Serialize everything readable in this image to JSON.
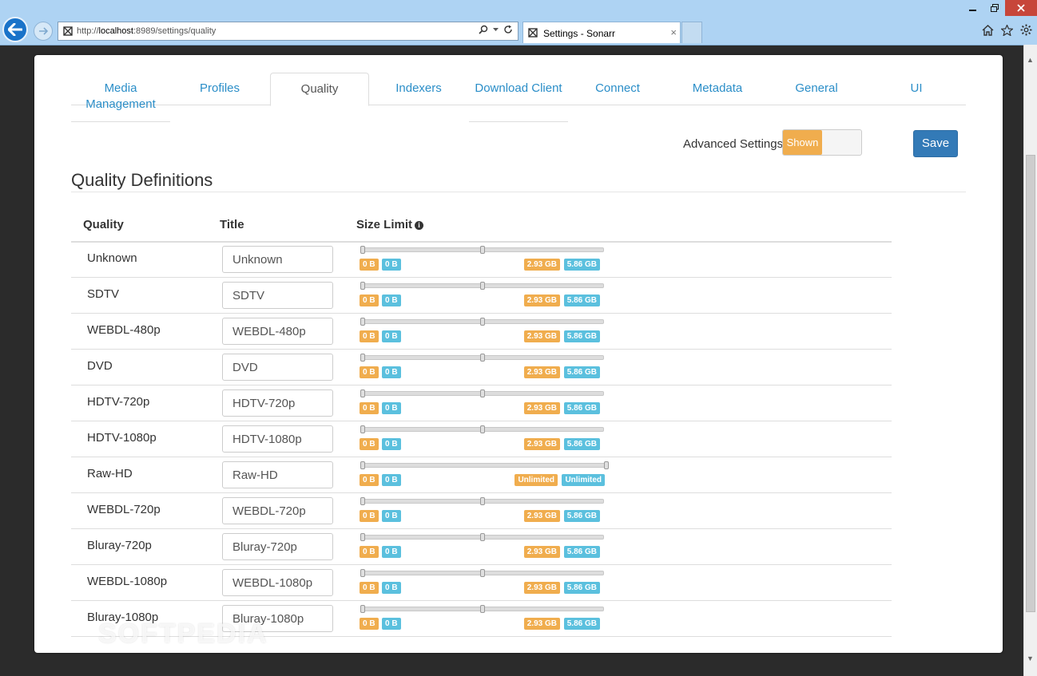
{
  "browser": {
    "url_prefix": "http://",
    "url_host": "localhost",
    "url_rest": ":8989/settings/quality",
    "tab_title": "Settings - Sonarr",
    "tab_close": "×"
  },
  "nav": {
    "tabs": [
      {
        "label": "Media Management"
      },
      {
        "label": "Profiles"
      },
      {
        "label": "Quality"
      },
      {
        "label": "Indexers"
      },
      {
        "label": "Download Client"
      },
      {
        "label": "Connect"
      },
      {
        "label": "Metadata"
      },
      {
        "label": "General"
      },
      {
        "label": "UI"
      }
    ],
    "active": "Quality"
  },
  "advanced": {
    "label": "Advanced Settings",
    "toggle_on_label": "Shown"
  },
  "save_label": "Save",
  "section_title": "Quality Definitions",
  "table": {
    "headers": {
      "quality": "Quality",
      "title": "Title",
      "size_limit": "Size Limit"
    },
    "rows": [
      {
        "quality": "Unknown",
        "title": "Unknown",
        "min": "0 B",
        "pref": "0 B",
        "max": "2.93 GB",
        "maxmax": "5.86 GB",
        "mid_fraction": 0.5
      },
      {
        "quality": "SDTV",
        "title": "SDTV",
        "min": "0 B",
        "pref": "0 B",
        "max": "2.93 GB",
        "maxmax": "5.86 GB",
        "mid_fraction": 0.5
      },
      {
        "quality": "WEBDL-480p",
        "title": "WEBDL-480p",
        "min": "0 B",
        "pref": "0 B",
        "max": "2.93 GB",
        "maxmax": "5.86 GB",
        "mid_fraction": 0.5
      },
      {
        "quality": "DVD",
        "title": "DVD",
        "min": "0 B",
        "pref": "0 B",
        "max": "2.93 GB",
        "maxmax": "5.86 GB",
        "mid_fraction": 0.5
      },
      {
        "quality": "HDTV-720p",
        "title": "HDTV-720p",
        "min": "0 B",
        "pref": "0 B",
        "max": "2.93 GB",
        "maxmax": "5.86 GB",
        "mid_fraction": 0.5
      },
      {
        "quality": "HDTV-1080p",
        "title": "HDTV-1080p",
        "min": "0 B",
        "pref": "0 B",
        "max": "2.93 GB",
        "maxmax": "5.86 GB",
        "mid_fraction": 0.5
      },
      {
        "quality": "Raw-HD",
        "title": "Raw-HD",
        "min": "0 B",
        "pref": "0 B",
        "max": "Unlimited",
        "maxmax": "Unlimited",
        "mid_fraction": 1.0
      },
      {
        "quality": "WEBDL-720p",
        "title": "WEBDL-720p",
        "min": "0 B",
        "pref": "0 B",
        "max": "2.93 GB",
        "maxmax": "5.86 GB",
        "mid_fraction": 0.5
      },
      {
        "quality": "Bluray-720p",
        "title": "Bluray-720p",
        "min": "0 B",
        "pref": "0 B",
        "max": "2.93 GB",
        "maxmax": "5.86 GB",
        "mid_fraction": 0.5
      },
      {
        "quality": "WEBDL-1080p",
        "title": "WEBDL-1080p",
        "min": "0 B",
        "pref": "0 B",
        "max": "2.93 GB",
        "maxmax": "5.86 GB",
        "mid_fraction": 0.5
      },
      {
        "quality": "Bluray-1080p",
        "title": "Bluray-1080p",
        "min": "0 B",
        "pref": "0 B",
        "max": "2.93 GB",
        "maxmax": "5.86 GB",
        "mid_fraction": 0.5
      }
    ]
  },
  "watermark": "SOFTPEDIA",
  "colors": {
    "accent": "#337ab7",
    "link": "#2b8ec8",
    "badge_orange": "#f0ad4e",
    "badge_blue": "#5bc0de"
  }
}
